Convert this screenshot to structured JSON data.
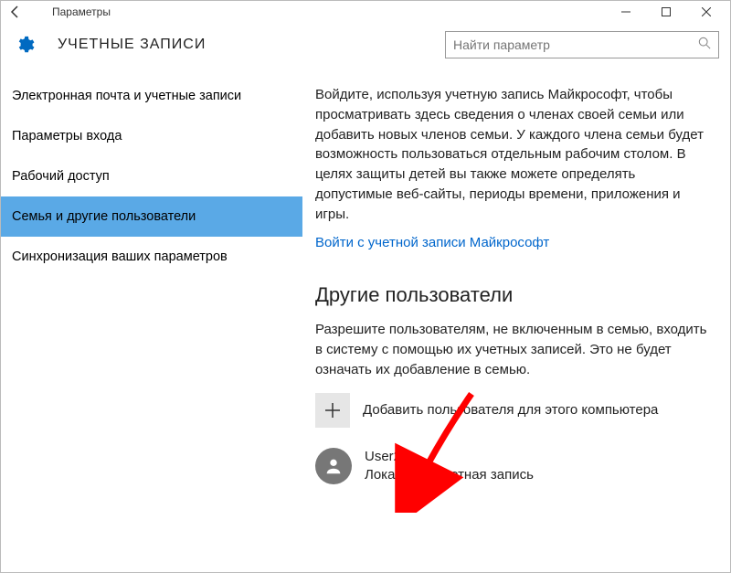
{
  "title_bar": {
    "title": "Параметры"
  },
  "header": {
    "title": "УЧЕТНЫЕ ЗАПИСИ"
  },
  "search": {
    "placeholder": "Найти параметр"
  },
  "sidebar": {
    "items": [
      {
        "label": "Электронная почта и учетные записи",
        "selected": false
      },
      {
        "label": "Параметры входа",
        "selected": false
      },
      {
        "label": "Рабочий доступ",
        "selected": false
      },
      {
        "label": "Семья и другие пользователи",
        "selected": true
      },
      {
        "label": "Синхронизация ваших параметров",
        "selected": false
      }
    ]
  },
  "main": {
    "family_info": "Войдите, используя учетную запись Майкрософт, чтобы просматривать здесь сведения о членах своей семьи или добавить новых членов семьи. У каждого члена семьи будет возможность пользоваться отдельным рабочим столом. В целях защиты детей вы также можете определять допустимые веб-сайты, периоды времени, приложения и игры.",
    "signin_link": "Войти с учетной записи Майкрософт",
    "other_users_heading": "Другие пользователи",
    "other_users_info": "Разрешите пользователям, не включенным в семью, входить в систему с помощью их учетных записей. Это не будет означать их добавление в семью.",
    "add_user_label": "Добавить пользователя для этого компьютера",
    "user": {
      "name": "User2",
      "type": "Локальная учетная запись"
    }
  }
}
